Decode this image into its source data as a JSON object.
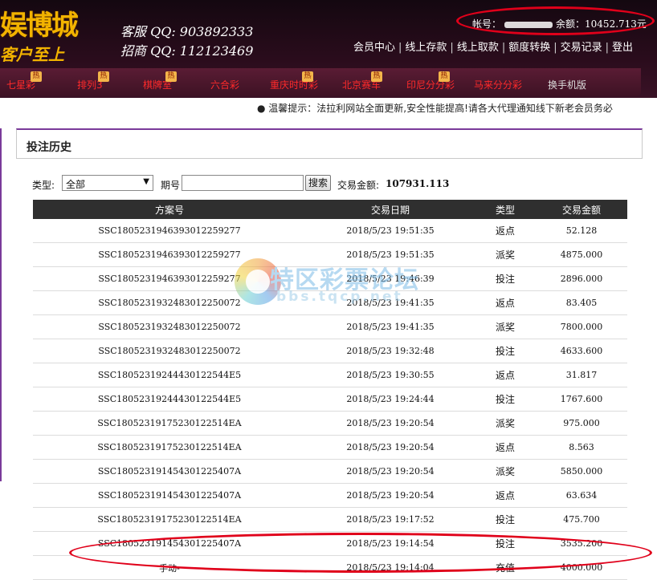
{
  "header": {
    "logo_main": "娱博城",
    "logo_sub": "客户至上",
    "qq_service": "客服 QQ: 903892333",
    "qq_merchant": "招商 QQ: 112123469",
    "account_label": "帐号：",
    "balance_label": "余额：",
    "balance_value": "10452.713元"
  },
  "user_nav": [
    "会员中心",
    "线上存款",
    "线上取款",
    "额度转换",
    "交易记录",
    "登出"
  ],
  "game_nav": [
    {
      "label": "七星彩",
      "hot": true
    },
    {
      "label": "排列3",
      "hot": true
    },
    {
      "label": "棋牌室",
      "hot": true
    },
    {
      "label": "六合彩",
      "hot": false
    },
    {
      "label": "重庆时时彩",
      "hot": true
    },
    {
      "label": "北京赛车",
      "hot": true
    },
    {
      "label": "印尼分分彩",
      "hot": true
    },
    {
      "label": "马来分分彩",
      "hot": false
    },
    {
      "label": "换手机版",
      "hot": false
    }
  ],
  "hot_badge": "热",
  "notice": "● 温馨提示：法拉利网站全面更新,安全性能提高!请各大代理通知线下新老会员务必",
  "panel": {
    "title": "投注历史"
  },
  "filters": {
    "type_label": "类型:",
    "type_value": "全部",
    "issue_label": "期号",
    "issue_value": "",
    "search_label": "搜索",
    "total_label": "交易金额:",
    "total_value": "107931.113"
  },
  "table": {
    "columns": [
      "方案号",
      "交易日期",
      "类型",
      "交易金额"
    ],
    "rows": [
      [
        "SSC180523194639301225927​7",
        "2018/5/23 19:51:35",
        "返点",
        "52.128"
      ],
      [
        "SSC1805231946393012259277",
        "2018/5/23 19:51:35",
        "派奖",
        "4875.000"
      ],
      [
        "SSC1805231946393012259277",
        "2018/5/23 19:46:39",
        "投注",
        "2896.000"
      ],
      [
        "SSC180523193248301225007​2",
        "2018/5/23 19:41:35",
        "返点",
        "83.405"
      ],
      [
        "SSC1805231932483012250072",
        "2018/5/23 19:41:35",
        "派奖",
        "7800.000"
      ],
      [
        "SSC1805231932483012250072",
        "2018/5/23 19:32:48",
        "投注",
        "4633.600"
      ],
      [
        "SSC18052319244430122544E5",
        "2018/5/23 19:30:55",
        "返点",
        "31.817"
      ],
      [
        "SSC18052319244430122544E5",
        "2018/5/23 19:24:44",
        "投注",
        "1767.600"
      ],
      [
        "SSC1805231917523012251​4EA",
        "2018/5/23 19:20:54",
        "派奖",
        "975.000"
      ],
      [
        "SSC18052319175230122514EA",
        "2018/5/23 19:20:54",
        "返点",
        "8.563"
      ],
      [
        "SSC1805231914543012254​07A",
        "2018/5/23 19:20:54",
        "派奖",
        "5850.000"
      ],
      [
        "SSC180523191454301225407A",
        "2018/5/23 19:20:54",
        "返点",
        "63.634"
      ],
      [
        "SSC18052319175230122514EA",
        "2018/5/23 19:17:52",
        "投注",
        "475.700"
      ],
      [
        "SSC180523191454301225407A",
        "2018/5/23 19:14:54",
        "投注",
        "3535.200"
      ],
      [
        "手动-",
        "2018/5/23 19:14:04",
        "充值",
        "4000.000"
      ]
    ]
  },
  "watermark": {
    "title": "特区彩票论坛",
    "url": "bbs.tqcp.net"
  }
}
